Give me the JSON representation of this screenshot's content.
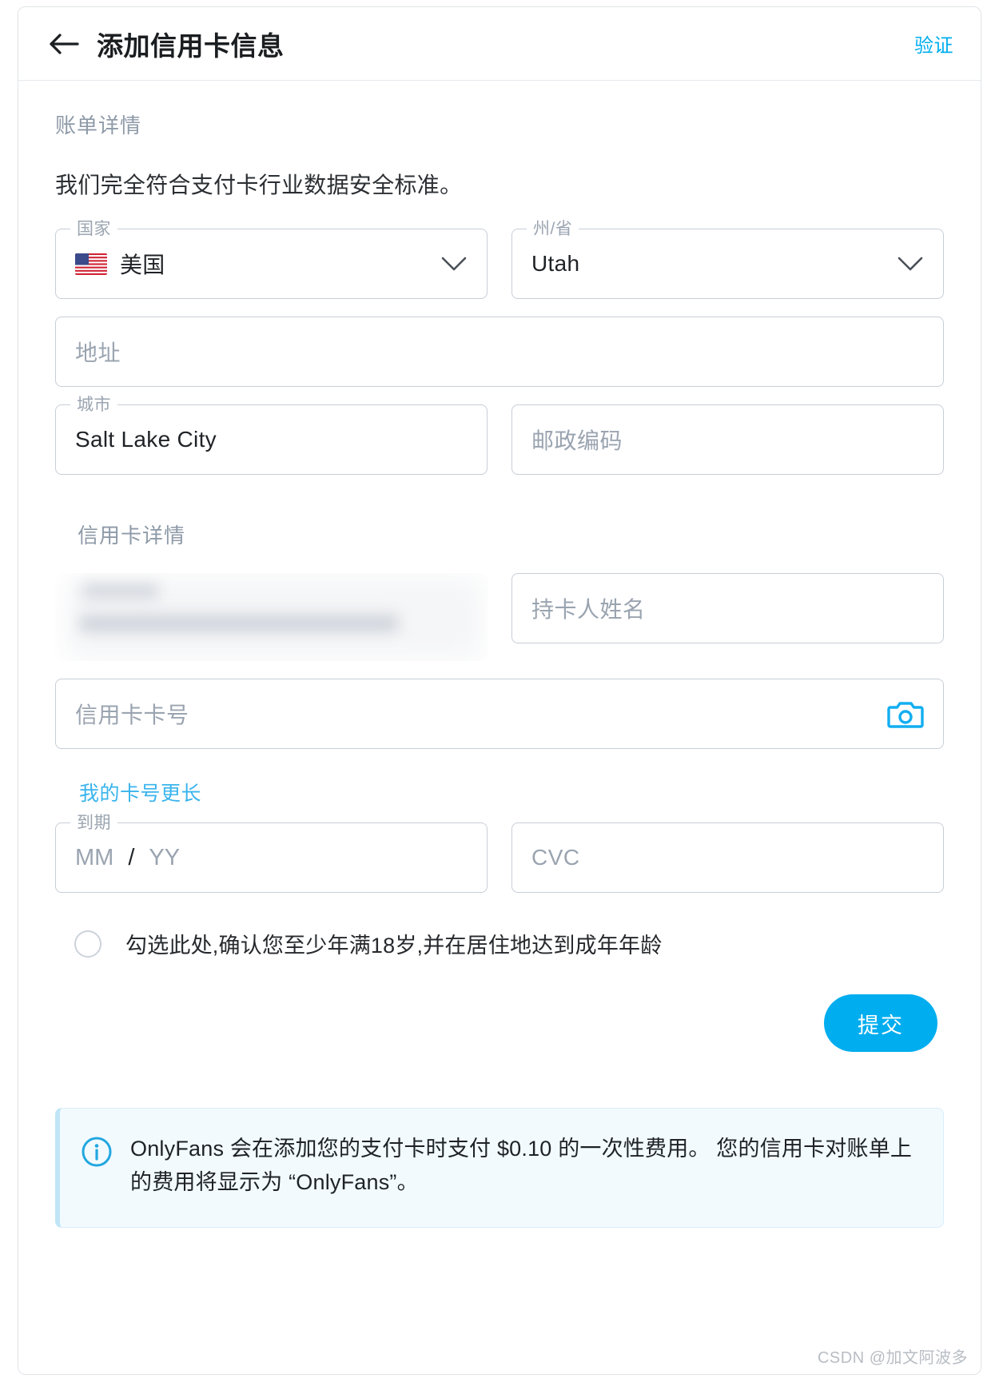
{
  "header": {
    "back_icon": "arrow-left-icon",
    "title": "添加信用卡信息",
    "action_label": "验证",
    "action_color": "#00aeef"
  },
  "billing": {
    "section_title": "账单详情",
    "lead_text": "我们完全符合支付卡行业数据安全标准。",
    "country": {
      "label": "国家",
      "value": "美国",
      "flag": "us-flag-icon"
    },
    "state": {
      "label": "州/省",
      "value": "Utah"
    },
    "address": {
      "placeholder": "地址",
      "value": ""
    },
    "city": {
      "label": "城市",
      "value": "Salt Lake City"
    },
    "postal": {
      "placeholder": "邮政编码",
      "value": ""
    }
  },
  "card": {
    "section_title": "信用卡详情",
    "email_field": {
      "redacted": true,
      "note": "blurred"
    },
    "holder": {
      "placeholder": "持卡人姓名",
      "value": ""
    },
    "number": {
      "placeholder": "信用卡卡号",
      "value": "",
      "camera_icon": "camera-icon",
      "camera_color": "#12aef0"
    },
    "longer_card_link": "我的卡号更长",
    "expiry": {
      "label": "到期",
      "mm_placeholder": "MM",
      "separator": "/",
      "yy_placeholder": "YY"
    },
    "cvc": {
      "placeholder": "CVC",
      "value": ""
    }
  },
  "consent": {
    "checked": false,
    "label": "勾选此处,确认您至少年满18岁,并在居住地达到成年年龄"
  },
  "submit": {
    "label": "提交",
    "color": "#00adef"
  },
  "info_banner": {
    "icon": "info-circle-icon",
    "icon_color": "#22a7e0",
    "text": "OnlyFans 会在添加您的支付卡时支付 $0.10 的一次性费用。 您的信用卡对账单上的费用将显示为 “OnlyFans”。"
  },
  "watermark": "CSDN @加文阿波多"
}
